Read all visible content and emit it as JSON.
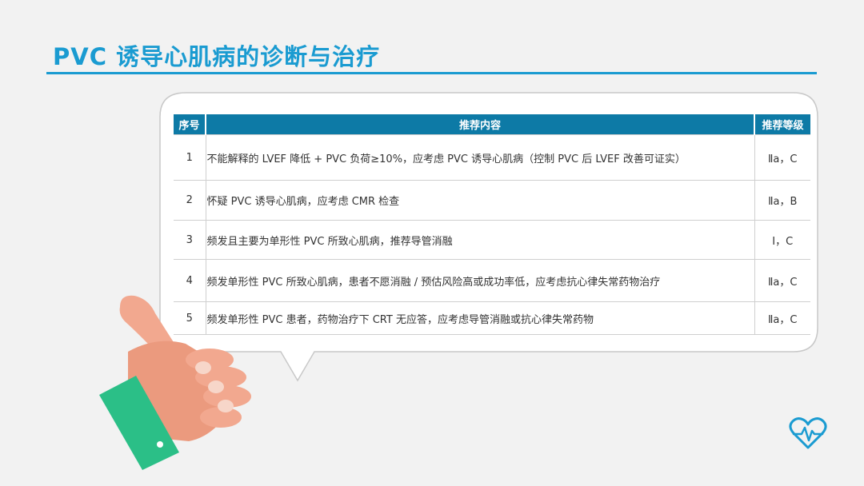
{
  "slide": {
    "title": "PVC 诱导心肌病的诊断与治疗",
    "accent_color": "#1a9bd1",
    "header_color": "#0d7aa6"
  },
  "table": {
    "headers": [
      "序号",
      "推荐内容",
      "推荐等级"
    ],
    "rows": [
      {
        "num": "1",
        "content": "不能解释的 LVEF 降低 + PVC 负荷≥10%，应考虑 PVC 诱导心肌病（控制 PVC 后 LVEF 改善可证实）",
        "grade": "Ⅱa，C"
      },
      {
        "num": "2",
        "content": "怀疑 PVC 诱导心肌病，应考虑 CMR 检查",
        "grade": "Ⅱa，B"
      },
      {
        "num": "3",
        "content": "频发且主要为单形性 PVC 所致心肌病，推荐导管消融",
        "grade": "Ⅰ，C"
      },
      {
        "num": "4",
        "content": "频发单形性 PVC 所致心肌病，患者不愿消融 / 预估风险高或成功率低，应考虑抗心律失常药物治疗",
        "grade": "Ⅱa，C"
      },
      {
        "num": "5",
        "content": "频发单形性 PVC 患者，药物治疗下 CRT 无应答，应考虑导管消融或抗心律失常药物",
        "grade": "Ⅱa，C"
      }
    ]
  },
  "icons": {
    "hand": "thumbs-up-hand-icon",
    "heart": "heart-pulse-icon"
  }
}
